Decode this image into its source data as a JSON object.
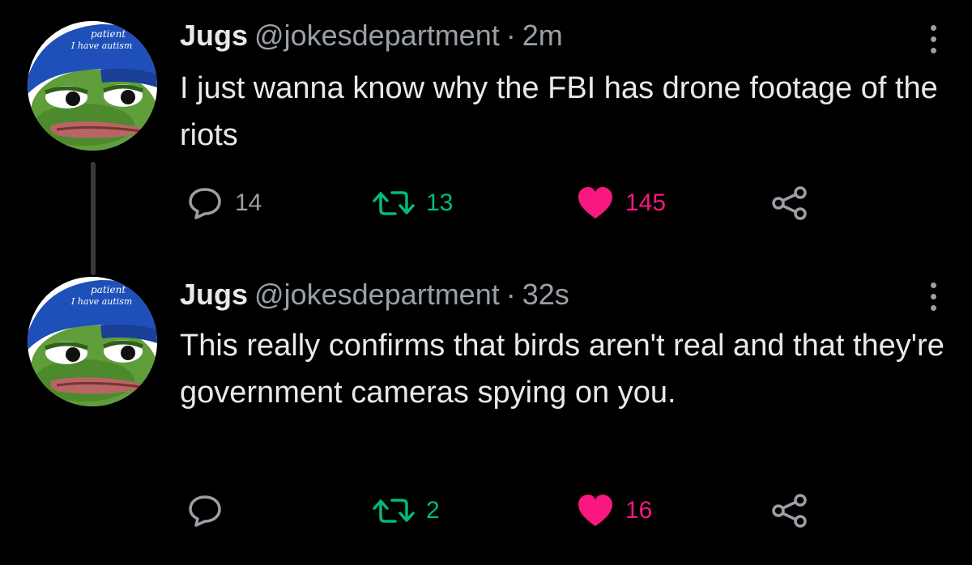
{
  "tweets": [
    {
      "name": "Jugs",
      "handle": "@jokesdepartment",
      "separator": "·",
      "time": "2m",
      "text": "I just wanna know why the FBI has drone footage of the riots",
      "replies": "14",
      "retweets": "13",
      "likes": "145",
      "avatar_hat_text": [
        "patient",
        "I have autism"
      ]
    },
    {
      "name": "Jugs",
      "handle": "@jokesdepartment",
      "separator": "·",
      "time": "32s",
      "text": "This really confirms that birds aren't real and that they're government cameras spying on you.",
      "replies": "",
      "retweets": "2",
      "likes": "16",
      "avatar_hat_text": [
        "patient",
        "I have autism"
      ]
    }
  ],
  "icons": {
    "reply": "reply-bubble-icon",
    "retweet": "retweet-arrows-icon",
    "like": "heart-icon",
    "share": "share-nodes-icon",
    "more": "more-vertical-icon"
  },
  "colors": {
    "background": "#000000",
    "text": "#e7e9ea",
    "muted": "#9aa0a6",
    "retweet": "#00ba7c",
    "like": "#f91880"
  }
}
